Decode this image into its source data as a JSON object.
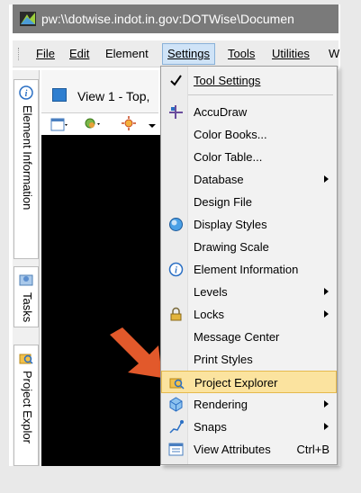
{
  "window": {
    "title": "pw:\\\\dotwise.indot.in.gov:DOTWise\\Documen"
  },
  "menubar": {
    "items": [
      "File",
      "Edit",
      "Element",
      "Settings",
      "Tools",
      "Utilities",
      "W"
    ],
    "active": "Settings"
  },
  "sidebar": {
    "tabs": [
      {
        "label": "Element Information",
        "icon": "info-icon"
      },
      {
        "label": "Tasks",
        "icon": "tasks-icon"
      },
      {
        "label": "Project Explor",
        "icon": "project-explorer-icon"
      }
    ]
  },
  "view": {
    "title": "View 1 - Top,"
  },
  "settings_menu": {
    "items": [
      {
        "label": "Tool Settings",
        "icon": "check-icon"
      },
      {
        "label": "AccuDraw",
        "icon": "accudraw-icon"
      },
      {
        "label": "Color Books...",
        "icon": ""
      },
      {
        "label": "Color Table...",
        "icon": ""
      },
      {
        "label": "Database",
        "icon": "",
        "submenu": true
      },
      {
        "label": "Design File",
        "icon": ""
      },
      {
        "label": "Display Styles",
        "icon": "display-styles-icon"
      },
      {
        "label": "Drawing Scale",
        "icon": ""
      },
      {
        "label": "Element Information",
        "icon": "info-icon"
      },
      {
        "label": "Levels",
        "icon": "",
        "submenu": true
      },
      {
        "label": "Locks",
        "icon": "lock-icon",
        "submenu": true
      },
      {
        "label": "Message Center",
        "icon": ""
      },
      {
        "label": "Print Styles",
        "icon": ""
      },
      {
        "label": "Project Explorer",
        "icon": "project-explorer-icon",
        "highlighted": true
      },
      {
        "label": "Rendering",
        "icon": "rendering-icon",
        "submenu": true
      },
      {
        "label": "Snaps",
        "icon": "snaps-icon",
        "submenu": true
      },
      {
        "label": "View Attributes",
        "icon": "view-attributes-icon",
        "shortcut": "Ctrl+B"
      }
    ]
  },
  "colors": {
    "highlight": "#fbe39f",
    "arrow": "#e2592b",
    "accent": "#2f7fd0"
  }
}
